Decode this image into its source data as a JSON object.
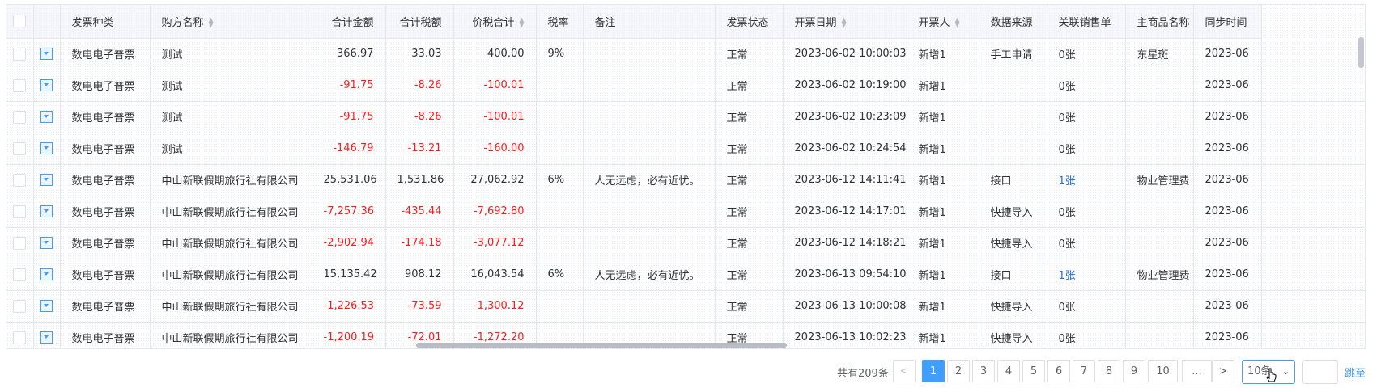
{
  "table": {
    "headers": [
      {
        "key": "type",
        "label": "发票种类",
        "sortable": false,
        "num": false
      },
      {
        "key": "buyer",
        "label": "购方名称",
        "sortable": true,
        "num": false
      },
      {
        "key": "amount",
        "label": "合计金额",
        "sortable": false,
        "num": true
      },
      {
        "key": "tax",
        "label": "合计税额",
        "sortable": false,
        "num": true
      },
      {
        "key": "total",
        "label": "价税合计",
        "sortable": true,
        "num": true
      },
      {
        "key": "rate",
        "label": "税率",
        "sortable": false,
        "num": false
      },
      {
        "key": "remark",
        "label": "备注",
        "sortable": false,
        "num": false
      },
      {
        "key": "status",
        "label": "发票状态",
        "sortable": false,
        "num": false
      },
      {
        "key": "date",
        "label": "开票日期",
        "sortable": true,
        "num": false
      },
      {
        "key": "issuer",
        "label": "开票人",
        "sortable": true,
        "num": false
      },
      {
        "key": "source",
        "label": "数据来源",
        "sortable": false,
        "num": false
      },
      {
        "key": "sales",
        "label": "关联销售单",
        "sortable": false,
        "num": false
      },
      {
        "key": "product",
        "label": "主商品名称",
        "sortable": false,
        "num": false
      },
      {
        "key": "sync",
        "label": "同步时间",
        "sortable": false,
        "num": false
      }
    ],
    "rows": [
      {
        "type": "数电电子普票",
        "buyer": "测试",
        "amount": "366.97",
        "tax": "33.03",
        "total": "400.00",
        "rate": "9%",
        "remark": "",
        "status": "正常",
        "date": "2023-06-02 10:00:03",
        "issuer": "新增1",
        "source": "手工申请",
        "sales": "0张",
        "product": "东星斑",
        "sync": "2023-06",
        "neg": false,
        "link": false
      },
      {
        "type": "数电电子普票",
        "buyer": "测试",
        "amount": "-91.75",
        "tax": "-8.26",
        "total": "-100.01",
        "rate": "",
        "remark": "",
        "status": "正常",
        "date": "2023-06-02 10:19:00",
        "issuer": "新增1",
        "source": "",
        "sales": "0张",
        "product": "",
        "sync": "2023-06",
        "neg": true,
        "link": false
      },
      {
        "type": "数电电子普票",
        "buyer": "测试",
        "amount": "-91.75",
        "tax": "-8.26",
        "total": "-100.01",
        "rate": "",
        "remark": "",
        "status": "正常",
        "date": "2023-06-02 10:23:09",
        "issuer": "新增1",
        "source": "",
        "sales": "0张",
        "product": "",
        "sync": "2023-06",
        "neg": true,
        "link": false
      },
      {
        "type": "数电电子普票",
        "buyer": "测试",
        "amount": "-146.79",
        "tax": "-13.21",
        "total": "-160.00",
        "rate": "",
        "remark": "",
        "status": "正常",
        "date": "2023-06-02 10:24:54",
        "issuer": "新增1",
        "source": "",
        "sales": "0张",
        "product": "",
        "sync": "2023-06",
        "neg": true,
        "link": false
      },
      {
        "type": "数电电子普票",
        "buyer": "中山新联假期旅行社有限公司",
        "amount": "25,531.06",
        "tax": "1,531.86",
        "total": "27,062.92",
        "rate": "6%",
        "remark": "人无远虑，必有近忧。",
        "status": "正常",
        "date": "2023-06-12 14:11:41",
        "issuer": "新增1",
        "source": "接口",
        "sales": "1张",
        "product": "物业管理费",
        "sync": "2023-06",
        "neg": false,
        "link": true
      },
      {
        "type": "数电电子普票",
        "buyer": "中山新联假期旅行社有限公司",
        "amount": "-7,257.36",
        "tax": "-435.44",
        "total": "-7,692.80",
        "rate": "",
        "remark": "",
        "status": "正常",
        "date": "2023-06-12 14:17:01",
        "issuer": "新增1",
        "source": "快捷导入",
        "sales": "0张",
        "product": "",
        "sync": "2023-06",
        "neg": true,
        "link": false
      },
      {
        "type": "数电电子普票",
        "buyer": "中山新联假期旅行社有限公司",
        "amount": "-2,902.94",
        "tax": "-174.18",
        "total": "-3,077.12",
        "rate": "",
        "remark": "",
        "status": "正常",
        "date": "2023-06-12 14:18:21",
        "issuer": "新增1",
        "source": "快捷导入",
        "sales": "0张",
        "product": "",
        "sync": "2023-06",
        "neg": true,
        "link": false
      },
      {
        "type": "数电电子普票",
        "buyer": "中山新联假期旅行社有限公司",
        "amount": "15,135.42",
        "tax": "908.12",
        "total": "16,043.54",
        "rate": "6%",
        "remark": "人无远虑，必有近忧。",
        "status": "正常",
        "date": "2023-06-13 09:54:10",
        "issuer": "新增1",
        "source": "接口",
        "sales": "1张",
        "product": "物业管理费",
        "sync": "2023-06",
        "neg": false,
        "link": true
      },
      {
        "type": "数电电子普票",
        "buyer": "中山新联假期旅行社有限公司",
        "amount": "-1,226.53",
        "tax": "-73.59",
        "total": "-1,300.12",
        "rate": "",
        "remark": "",
        "status": "正常",
        "date": "2023-06-13 10:00:08",
        "issuer": "新增1",
        "source": "快捷导入",
        "sales": "0张",
        "product": "",
        "sync": "2023-06",
        "neg": true,
        "link": false
      },
      {
        "type": "数电电子普票",
        "buyer": "中山新联假期旅行社有限公司",
        "amount": "-1,200.19",
        "tax": "-72.01",
        "total": "-1,272.20",
        "rate": "",
        "remark": "",
        "status": "正常",
        "date": "2023-06-13 10:02:23",
        "issuer": "新增1",
        "source": "快捷导入",
        "sales": "0张",
        "product": "",
        "sync": "2023-06",
        "neg": true,
        "link": false
      }
    ]
  },
  "pagination": {
    "total_text": "共有209条",
    "prev": "<",
    "next": ">",
    "pages": [
      "1",
      "2",
      "3",
      "4",
      "5",
      "6",
      "7",
      "8",
      "9",
      "10",
      "..."
    ],
    "current": "1",
    "page_size": "10条",
    "jump_label": "跳至"
  },
  "colors": {
    "accent": "#409eff",
    "negative": "#ff1a1a",
    "link": "#1f6fe0"
  },
  "icons": {
    "expand": "expand-caret-icon",
    "sort": "sort-caret-icon",
    "cursor": "mouse-pointer-icon"
  }
}
